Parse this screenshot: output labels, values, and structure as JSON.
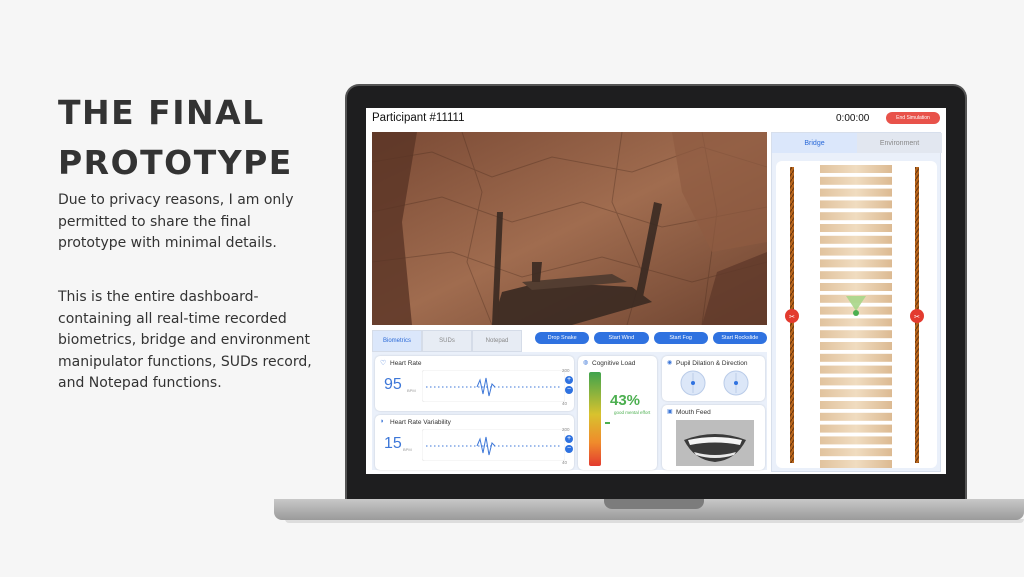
{
  "slide": {
    "heading_line1": "THE FINAL",
    "heading_line2": "PROTOTYPE",
    "para1": "Due to privacy reasons, I am only permitted to share the final prototype with minimal details.",
    "para2": "This is the entire dashboard- containing all real-time recorded biometrics, bridge and environment manipulator functions, SUDs record, and Notepad functions."
  },
  "dashboard": {
    "participant": "Participant #11111",
    "timer": "0:00:00",
    "end_button": "End Simulation",
    "left_tabs": [
      "Biometrics",
      "SUDs",
      "Notepad"
    ],
    "controls": [
      "Drop Snake",
      "Start Wind",
      "Start Fog",
      "Start Rockslide"
    ],
    "heart_rate": {
      "title": "Heart Rate",
      "value": "95",
      "unit": "BPM",
      "max": "200",
      "min": "40"
    },
    "hrv": {
      "title": "Heart Rate Variability",
      "value": "15",
      "unit": "BPM",
      "max": "200",
      "min": "40"
    },
    "cognitive": {
      "title": "Cognitive Load",
      "percent": "43%",
      "caption": "good mental effort",
      "level": 0.43
    },
    "pupil": {
      "title": "Pupil Dilation & Direction"
    },
    "mouth": {
      "title": "Mouth Feed"
    },
    "right_tabs": [
      "Bridge",
      "Environment"
    ]
  },
  "colors": {
    "accent": "#2f72e0",
    "danger": "#e8524a",
    "good": "#4caf50"
  }
}
